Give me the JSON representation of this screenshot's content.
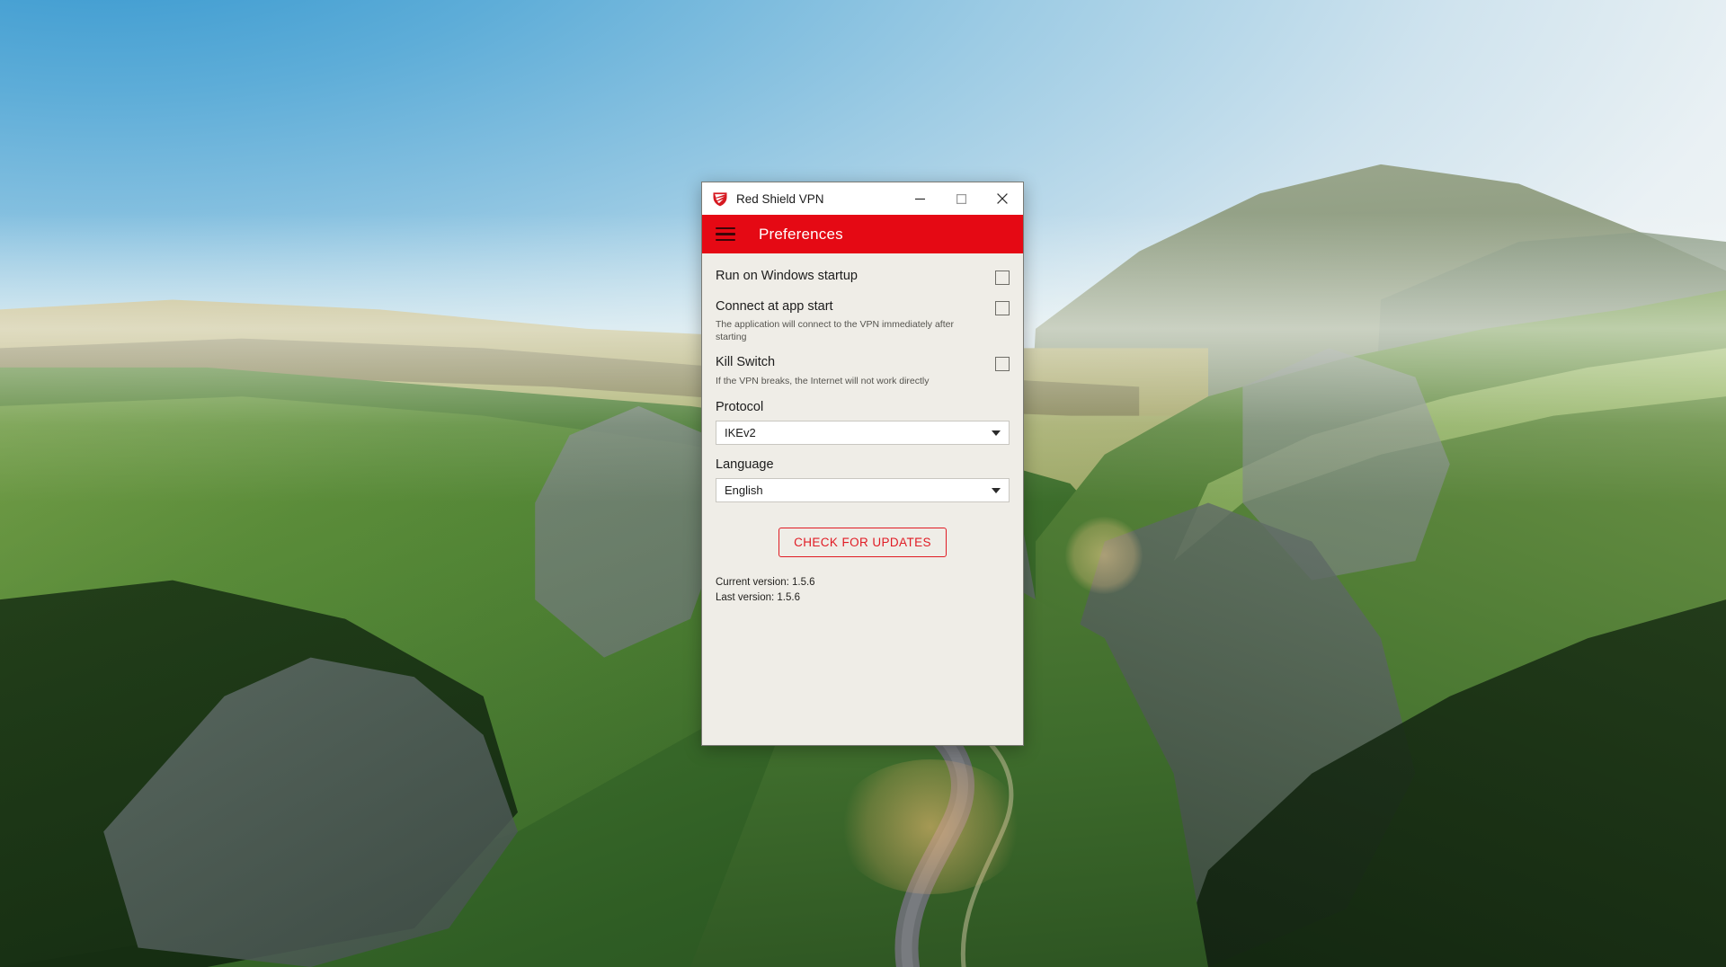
{
  "window": {
    "title": "Red Shield VPN",
    "logo_icon": "red-shield-logo",
    "minimize_icon": "minimize-icon",
    "maximize_icon": "maximize-icon",
    "close_icon": "close-icon",
    "accent_color": "#e50914",
    "body_color": "#efede7"
  },
  "appbar": {
    "menu_icon": "hamburger-menu-icon",
    "title": "Preferences"
  },
  "settings": {
    "run_on_startup": {
      "label": "Run on Windows startup",
      "checked": false
    },
    "connect_at_app_start": {
      "label": "Connect at app start",
      "description": "The application will connect to the VPN immediately after starting",
      "checked": false
    },
    "kill_switch": {
      "label": "Kill Switch",
      "description": "If the VPN breaks, the Internet will not work directly",
      "checked": false
    },
    "protocol": {
      "label": "Protocol",
      "value": "IKEv2",
      "caret_icon": "chevron-down-icon"
    },
    "language": {
      "label": "Language",
      "value": "English",
      "caret_icon": "chevron-down-icon"
    }
  },
  "updates": {
    "button_label": "CHECK FOR UPDATES",
    "button_color": "#e01b24",
    "current_version": "Current version: 1.5.6",
    "last_version": "Last version: 1.5.6"
  },
  "desktop": {
    "wallpaper_description": "Aerial photo of green limestone hills with a winding road at sunrise"
  }
}
